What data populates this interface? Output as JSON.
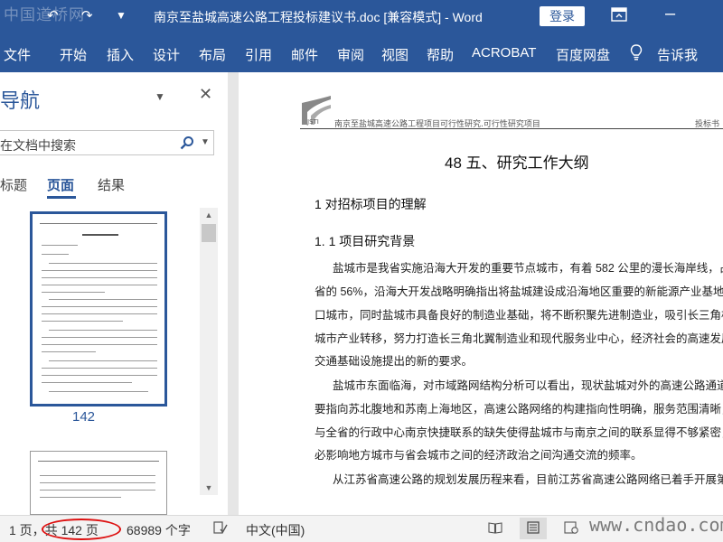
{
  "titlebar": {
    "watermark": "中国道桥网",
    "document_title": "南京至盐城高速公路工程投标建议书.doc [兼容模式] - Word",
    "login_label": "登录"
  },
  "ribbon": {
    "tabs": [
      "文件",
      "开始",
      "插入",
      "设计",
      "布局",
      "引用",
      "邮件",
      "审阅",
      "视图",
      "帮助",
      "ACROBAT",
      "百度网盘"
    ],
    "tell_me": "告诉我"
  },
  "nav_pane": {
    "title": "导航",
    "search_placeholder": "在文档中搜索",
    "tabs": [
      "标题",
      "页面",
      "结果"
    ],
    "active_tab": "页面",
    "thumbnail_caption": "142"
  },
  "document": {
    "header_text": "南京至盐城高速公路工程项目可行性研究.可行性研究项目",
    "header_right": "投标书",
    "heading": "48 五、研究工作大纲",
    "section1": "1  对招标项目的理解",
    "section1_1": "1. 1 项目研究背景",
    "paragraphs": [
      "盐城市是我省实施沿海大开发的重要节点城市，有着 582 公里的漫长海岸线，占全",
      "省的 56%，沿海大开发战略明确指出将盐城建设成沿海地区重要的新能源产业基地和港",
      "口城市，同时盐城市具备良好的制造业基础，将不断积聚先进制造业，吸引长三角核心",
      "城市产业转移，努力打造长三角北翼制造业和现代服务业中心，经济社会的高速发展对",
      "交通基础设施提出的新的要求。",
      "盐城市东面临海，对市域路网结构分析可以看出，现状盐城对外的高速公路通道主",
      "要指向苏北腹地和苏南上海地区，高速公路网络的构建指向性明确，服务范围清晰，而",
      "与全省的行政中心南京快捷联系的缺失使得盐城市与南京之间的联系显得不够紧密，势",
      "必影响地方城市与省会城市之间的经济政治之间沟通交流的频率。",
      "从江苏省高速公路的规划发展历程来看，目前江苏省高速公路网络已着手开展第三"
    ]
  },
  "statusbar": {
    "page_of": "1 页，共 142 页",
    "word_count": "68989 个字",
    "language": "中文(中国)",
    "watermark": "www.cndao.com"
  },
  "colors": {
    "accent": "#2b579a",
    "highlight_oval": "#dd1111"
  }
}
